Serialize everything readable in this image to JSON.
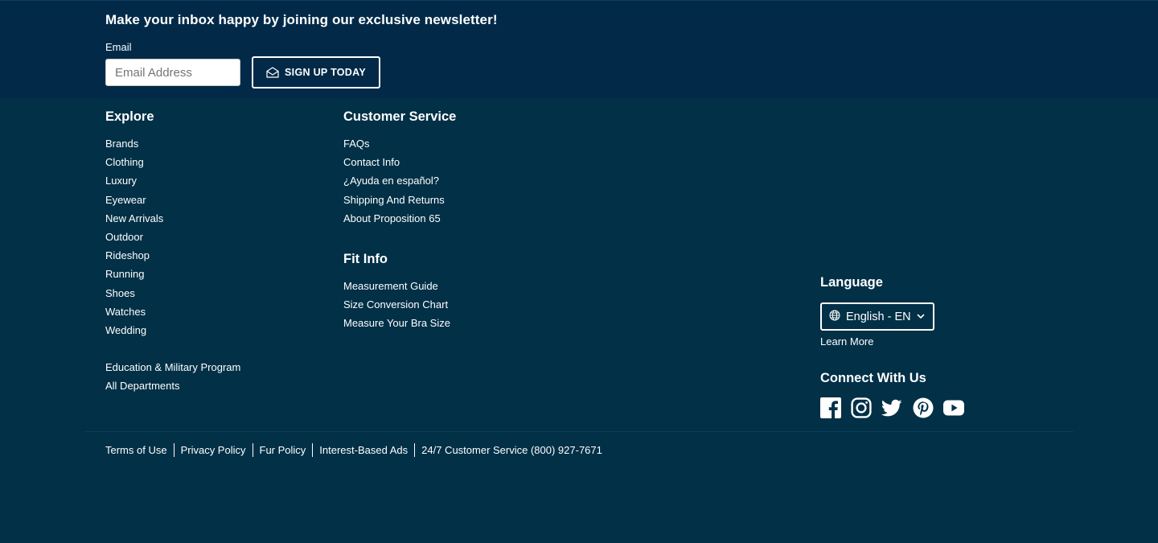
{
  "newsletter": {
    "heading": "Make your inbox happy by joining our exclusive newsletter!",
    "email_label": "Email",
    "email_placeholder": "Email Address",
    "email_value": "",
    "signup_label": "SIGN UP TODAY",
    "signup_icon": "envelope-open-icon"
  },
  "explore": {
    "heading": "Explore",
    "items": [
      "Brands",
      "Clothing",
      "Luxury",
      "Eyewear",
      "New Arrivals",
      "Outdoor",
      "Rideshop",
      "Running",
      "Shoes",
      "Watches",
      "Wedding"
    ],
    "extra_items": [
      "Education & Military Program",
      "All Departments"
    ]
  },
  "customer_service": {
    "heading": "Customer Service",
    "items": [
      "FAQs",
      "Contact Info",
      "¿Ayuda en español?",
      "Shipping And Returns",
      "About Proposition 65"
    ]
  },
  "fit_info": {
    "heading": "Fit Info",
    "items": [
      "Measurement Guide",
      "Size Conversion Chart",
      "Measure Your Bra Size"
    ]
  },
  "language": {
    "heading": "Language",
    "selected": "English - EN",
    "icon": "globe-icon",
    "learn_more": "Learn More"
  },
  "connect": {
    "heading": "Connect With Us",
    "networks": [
      "facebook-icon",
      "instagram-icon",
      "twitter-icon",
      "pinterest-icon",
      "youtube-icon"
    ]
  },
  "legal": {
    "links": [
      "Terms of Use",
      "Privacy Policy",
      "Fur Policy",
      "Interest-Based Ads",
      "24/7 Customer Service (800) 927-7671"
    ]
  },
  "colors": {
    "newsletter_bg": "#022a48",
    "footer_bg": "#013047",
    "text": "#ffffff"
  }
}
